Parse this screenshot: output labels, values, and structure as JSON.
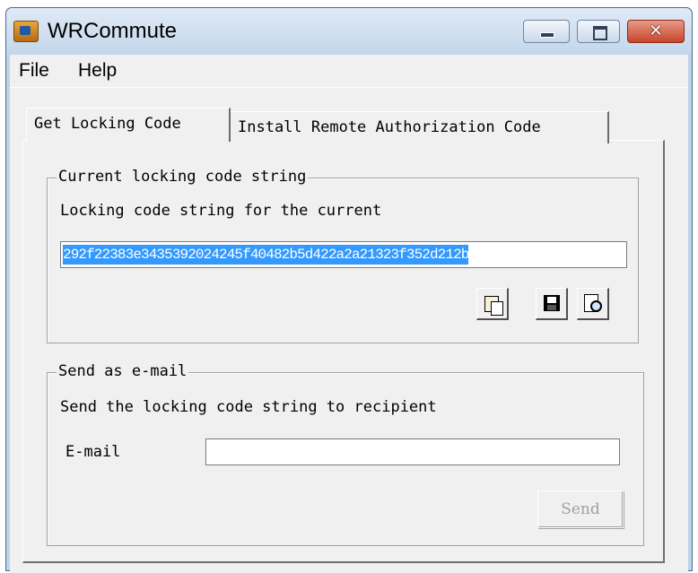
{
  "window": {
    "title": "WRCommute",
    "icon": "app-icon",
    "controls": {
      "minimize": "minimize-icon",
      "maximize": "maximize-icon",
      "close": "close-icon"
    }
  },
  "menu": {
    "items": [
      "File",
      "Help"
    ]
  },
  "tabs": [
    {
      "label": "Get Locking Code",
      "active": true
    },
    {
      "label": "Install Remote Authorization Code",
      "active": false
    }
  ],
  "locking_group": {
    "title": "Current locking code string",
    "description": "Locking code string for the current",
    "code_value": "292f22383e3435392024245f40482b5d422a2a21323f352d212b",
    "buttons": [
      "copy-icon",
      "save-icon",
      "view-icon"
    ]
  },
  "email_group": {
    "title": "Send as e-mail",
    "description": "Send the locking code string to recipient",
    "email_label": "E-mail",
    "email_value": "",
    "send_label": "Send"
  },
  "colors": {
    "selection": "#3399ff",
    "title_bg": "#c3d6eb",
    "close": "#c7452b"
  }
}
